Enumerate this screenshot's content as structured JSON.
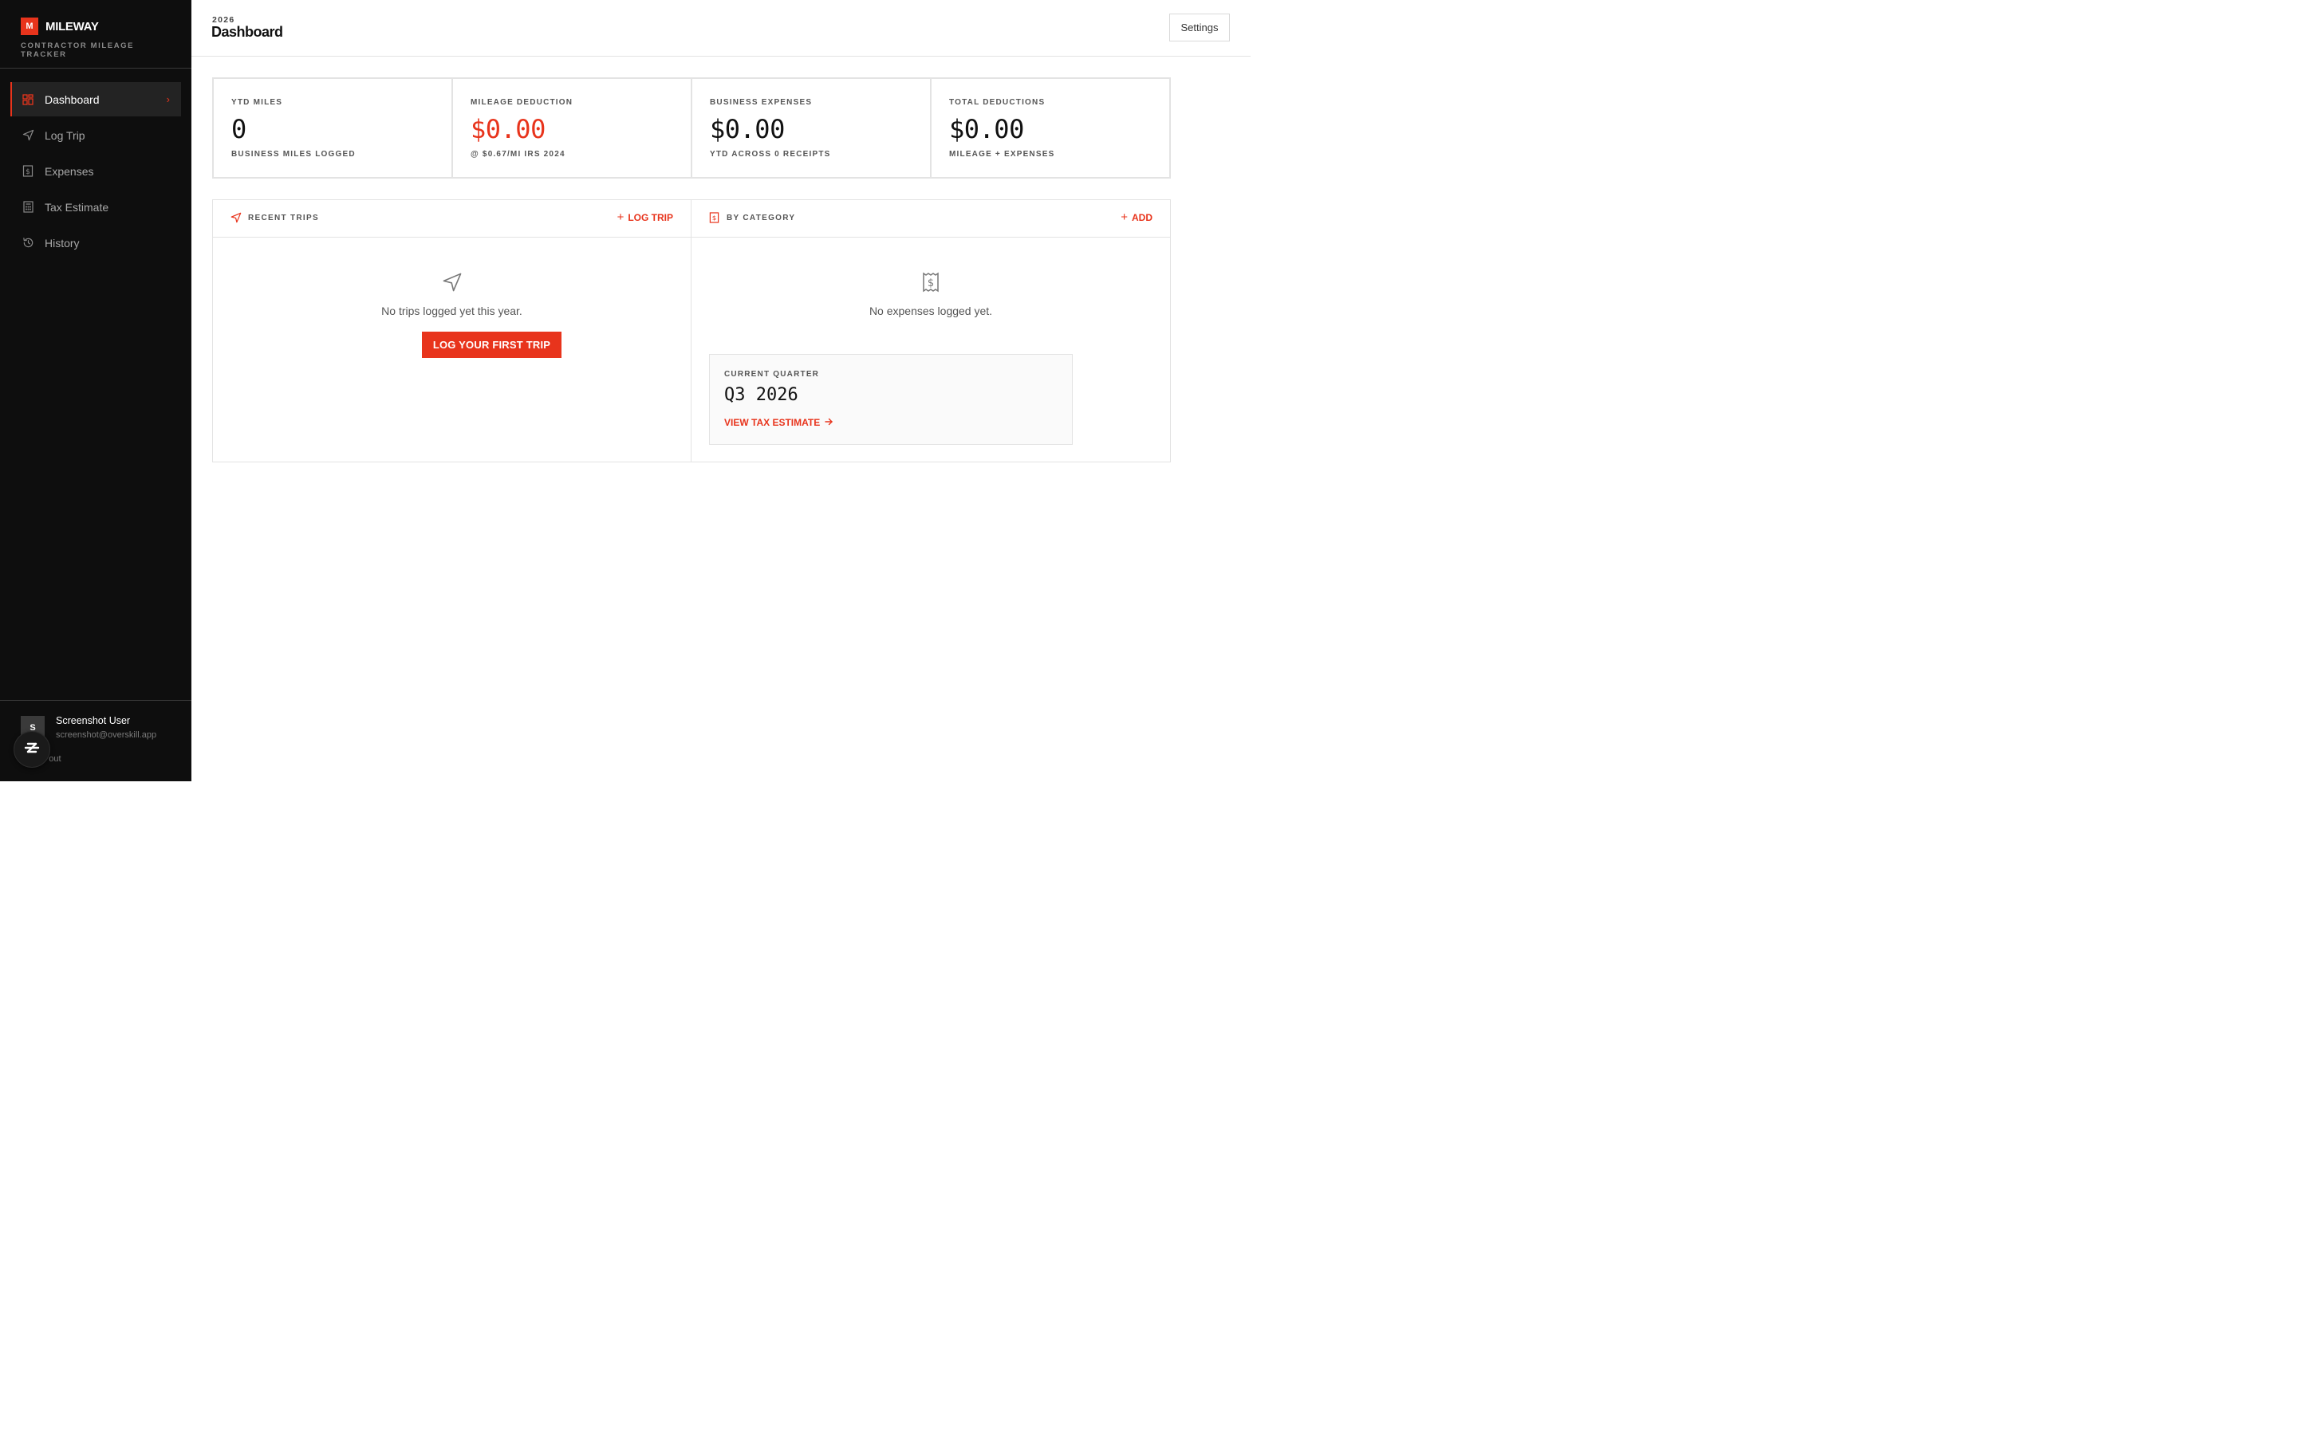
{
  "brand": {
    "logo_letter": "M",
    "name": "MILEWAY",
    "tagline": "CONTRACTOR MILEAGE TRACKER"
  },
  "nav": {
    "items": [
      {
        "label": "Dashboard",
        "icon": "dashboard-grid-icon",
        "active": true
      },
      {
        "label": "Log Trip",
        "icon": "navigation-arrow-icon"
      },
      {
        "label": "Expenses",
        "icon": "receipt-icon"
      },
      {
        "label": "Tax Estimate",
        "icon": "calculator-icon"
      },
      {
        "label": "History",
        "icon": "history-icon"
      }
    ]
  },
  "user": {
    "initial": "S",
    "name": "Screenshot User",
    "email": "screenshot@overskill.app",
    "signout": "gn out"
  },
  "header": {
    "year": "2026",
    "title": "Dashboard",
    "settings_label": "Settings"
  },
  "stats": [
    {
      "label": "YTD MILES",
      "value": "0",
      "sub": "BUSINESS MILES LOGGED"
    },
    {
      "label": "MILEAGE DEDUCTION",
      "value": "$0.00",
      "sub": "@ $0.67/MI IRS 2024"
    },
    {
      "label": "BUSINESS EXPENSES",
      "value": "$0.00",
      "sub": "YTD ACROSS 0 RECEIPTS"
    },
    {
      "label": "TOTAL DEDUCTIONS",
      "value": "$0.00",
      "sub": "MILEAGE + EXPENSES"
    }
  ],
  "trips_panel": {
    "title": "RECENT TRIPS",
    "action_label": "LOG TRIP",
    "empty_text": "No trips logged yet this year.",
    "cta_label": "LOG YOUR FIRST TRIP"
  },
  "category_panel": {
    "title": "BY CATEGORY",
    "action_label": "ADD",
    "empty_text": "No expenses logged yet.",
    "quarter_label": "CURRENT QUARTER",
    "quarter_value": "Q3 2026",
    "quarter_link": "VIEW TAX ESTIMATE"
  },
  "colors": {
    "accent": "#e8341c",
    "sidebar_bg": "#0e0e0e",
    "border": "#e3e3e3"
  }
}
